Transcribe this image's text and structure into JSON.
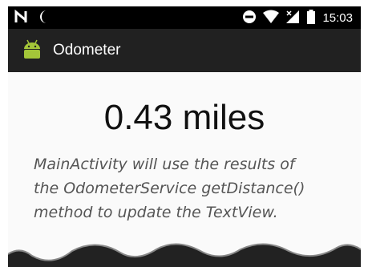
{
  "status_bar": {
    "time": "15:03",
    "icons_left": [
      "notification-n-icon",
      "moon-icon"
    ],
    "icons_right": [
      "do-not-disturb-icon",
      "wifi-icon",
      "signal-icon",
      "battery-icon"
    ]
  },
  "app_bar": {
    "title": "Odometer",
    "icon": "android-icon"
  },
  "main": {
    "distance_text": "0.43 miles",
    "annotation_text": "MainActivity will use the results of\nthe OdometerService getDistance()\nmethod to update the TextView."
  },
  "colors": {
    "status_bar": "#000000",
    "app_bar": "#212121",
    "android_green": "#a4c639",
    "background": "#fafafa",
    "annotation": "#555555"
  }
}
